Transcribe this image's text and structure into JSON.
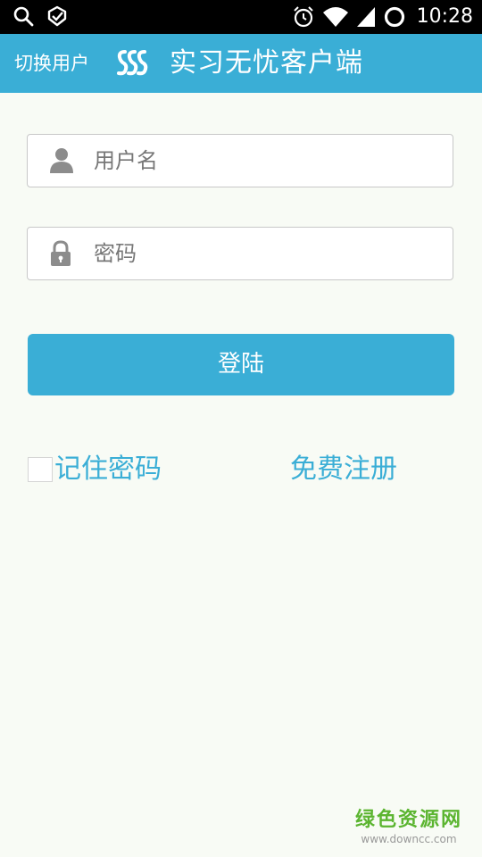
{
  "status_bar": {
    "time": "10:28",
    "icons": [
      "search-icon",
      "notification-check-icon",
      "alarm-icon",
      "wifi-icon",
      "cell-signal-icon",
      "sync-ring-icon"
    ]
  },
  "app_bar": {
    "switch_user": "切换用户",
    "title": "实习无忧客户端",
    "logo": "sss-logo"
  },
  "form": {
    "username": {
      "placeholder": "用户名",
      "value": "",
      "icon": "person-icon"
    },
    "password": {
      "placeholder": "密码",
      "value": "",
      "icon": "lock-icon"
    },
    "login_button": "登陆",
    "remember_label": "记住密码",
    "remember_checked": false,
    "register_link": "免费注册"
  },
  "watermark": {
    "title": "绿色资源网",
    "url": "www.downcc.com"
  },
  "colors": {
    "accent": "#3aaed6",
    "background": "#f8fbf5",
    "watermark": "#5cb531"
  }
}
